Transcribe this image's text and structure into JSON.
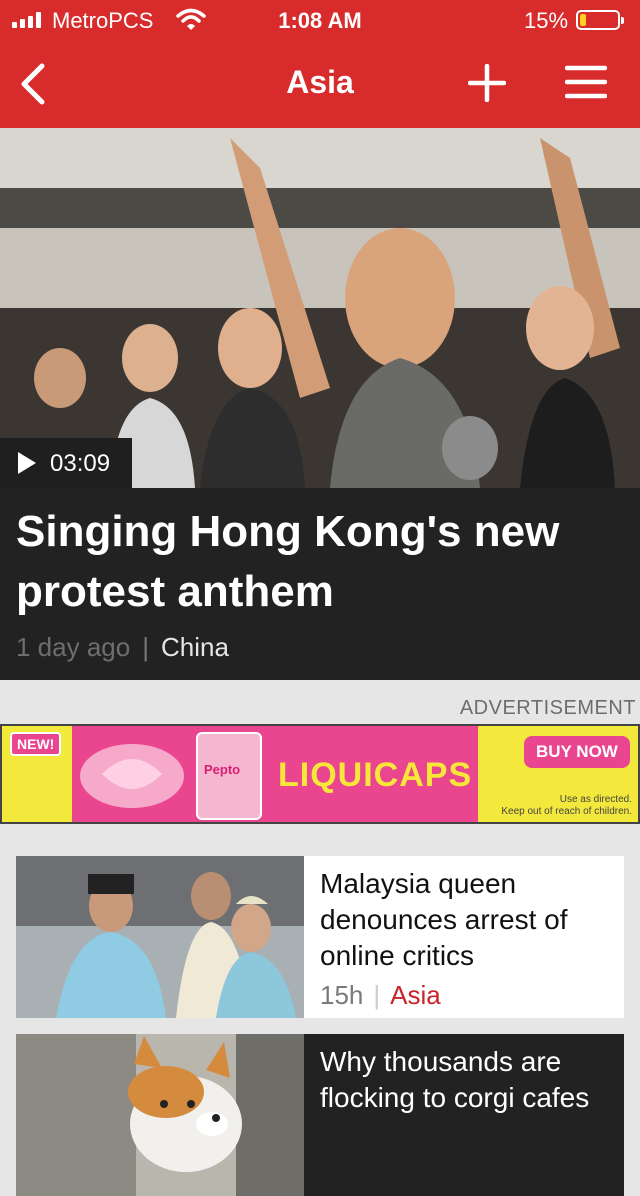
{
  "status_bar": {
    "carrier": "MetroPCS",
    "time": "1:08 AM",
    "battery": "15%"
  },
  "nav": {
    "title": "Asia",
    "icons": [
      "back-chevron-icon",
      "plus-icon",
      "hamburger-menu-icon"
    ]
  },
  "hero": {
    "duration": "03:09",
    "title": "Singing Hong Kong's new protest anthem",
    "age": "1 day ago",
    "tag": "China"
  },
  "ad": {
    "label": "ADVERTISEMENT",
    "badge": "NEW!",
    "pack": "Pepto",
    "brand": "LIQUICAPS",
    "cta": "BUY NOW",
    "fine_1": "Use as directed.",
    "fine_2": "Keep out of reach of children."
  },
  "stories": [
    {
      "title": "Malaysia queen denounces arrest of online critics",
      "age": "15h",
      "tag": "Asia"
    },
    {
      "title": "Why thousands are flocking to corgi cafes"
    }
  ],
  "colors": {
    "brand_red": "#d82b2b",
    "tag_red": "#c8242b",
    "dark_card": "#222222"
  }
}
